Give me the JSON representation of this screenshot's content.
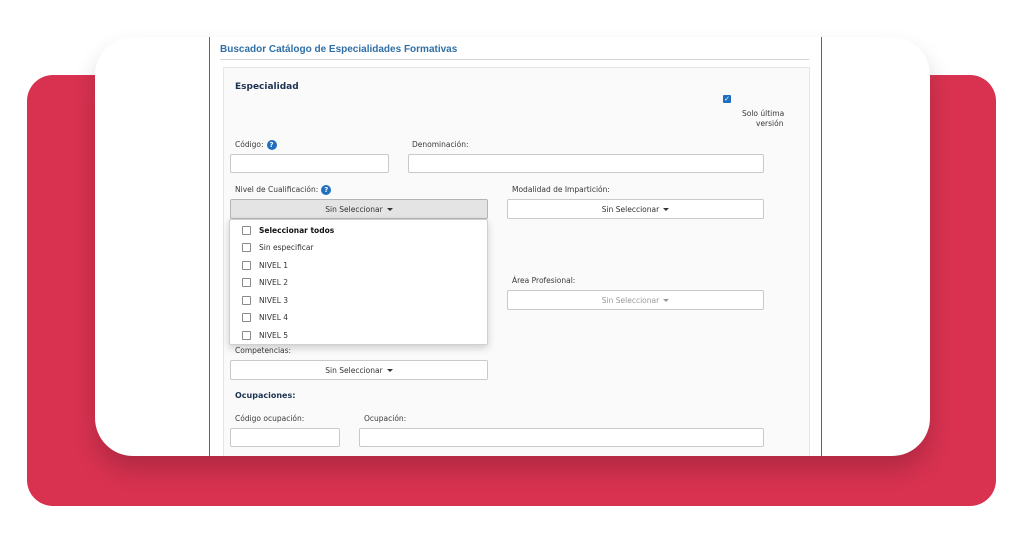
{
  "app_title": "Buscador Catálogo de Especialidades Formativas",
  "section_especialidad": "Especialidad",
  "solo_ultima_version": {
    "label_line1": "Solo última",
    "label_line2": "versión",
    "checked": true,
    "check_glyph": "✓"
  },
  "fields": {
    "codigo_label": "Código:",
    "denominacion_label": "Denominación:",
    "nivel_label": "Nivel de Cualificación:",
    "modalidad_label": "Modalidad de Impartición:",
    "area_label": "Área Profesional:",
    "competencias_label": "Competencias:",
    "help_glyph": "?"
  },
  "selects": {
    "nivel_value": "Sin Seleccionar",
    "modalidad_value": "Sin Seleccionar",
    "area_value": "Sin Seleccionar",
    "competencias_value": "Sin Seleccionar"
  },
  "dropdown_items": [
    {
      "label": "Seleccionar todos",
      "bold": true
    },
    {
      "label": "Sin especificar",
      "bold": false
    },
    {
      "label": "NIVEL 1",
      "bold": false
    },
    {
      "label": "NIVEL 2",
      "bold": false
    },
    {
      "label": "NIVEL 3",
      "bold": false
    },
    {
      "label": "NIVEL 4",
      "bold": false
    },
    {
      "label": "NIVEL 5",
      "bold": false
    }
  ],
  "section_ocupaciones": "Ocupaciones:",
  "ocupaciones": {
    "codigo_label": "Código ocupación:",
    "ocupacion_label": "Ocupación:"
  },
  "colors": {
    "accent": "#d83250",
    "brand_blue": "#2f6fa6",
    "help_blue": "#1f6fc0"
  }
}
